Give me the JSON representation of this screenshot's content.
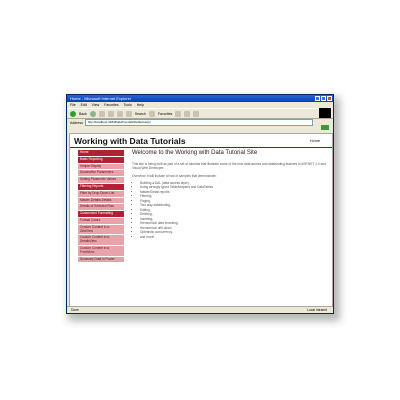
{
  "window": {
    "title": "Home - Microsoft Internet Explorer",
    "menu": [
      "File",
      "Edit",
      "View",
      "Favorites",
      "Tools",
      "Help"
    ],
    "toolbar": {
      "back_label": "Back",
      "search_label": "Search",
      "favorites_label": "Favorites"
    },
    "address": {
      "label": "Address",
      "value": "http://localhost:4184/DataTutorials/Default.aspx"
    },
    "status": {
      "left": "Done",
      "right": "Local intranet"
    }
  },
  "site": {
    "title": "Working with Data Tutorials",
    "home_link": "Home",
    "nav": [
      {
        "label": "Home",
        "kind": "section"
      },
      {
        "label": "Basic Reporting",
        "kind": "section"
      },
      {
        "label": "Simple Display",
        "kind": "sub"
      },
      {
        "label": "Declarative Parameters",
        "kind": "sub"
      },
      {
        "label": "Setting Parameter Values",
        "kind": "sub"
      },
      {
        "label": "Filtering Reports",
        "kind": "section"
      },
      {
        "label": "Filter by Drop-Down List",
        "kind": "sub"
      },
      {
        "label": "Master-Details-Details",
        "kind": "sub"
      },
      {
        "label": "Details of Selected Row",
        "kind": "sub"
      },
      {
        "label": "Customized Formatting",
        "kind": "section"
      },
      {
        "label": "Format Colors",
        "kind": "sub"
      },
      {
        "label": "Custom Content in a GridView",
        "kind": "sub"
      },
      {
        "label": "Custom Content in a DetailsView",
        "kind": "sub"
      },
      {
        "label": "Custom Content in a FormView",
        "kind": "sub"
      },
      {
        "label": "Summary Data in Footer",
        "kind": "sub"
      }
    ],
    "main": {
      "heading": "Welcome to the Working with Data Tutorial Site",
      "intro": "This site is being built as part of a set of tutorials that illustrate some of the new data access and databinding features in ASP.NET 2.0 and Visual Web Developer.",
      "overview": "Overview: it will include a host of samples that demonstrate:",
      "bullets": [
        "Building a DAL (data access layer),",
        "Using strongly typed TableAdapters and DataTables",
        "Master/Detail reports",
        "Filtering",
        "Paging,",
        "Two-way databinding,",
        "Editing,",
        "Deleting,",
        "Inserting,",
        "Hierarchical data browsing,",
        "Hierarchical drill-down,",
        "Optimistic concurrency,",
        "and more!"
      ]
    }
  }
}
